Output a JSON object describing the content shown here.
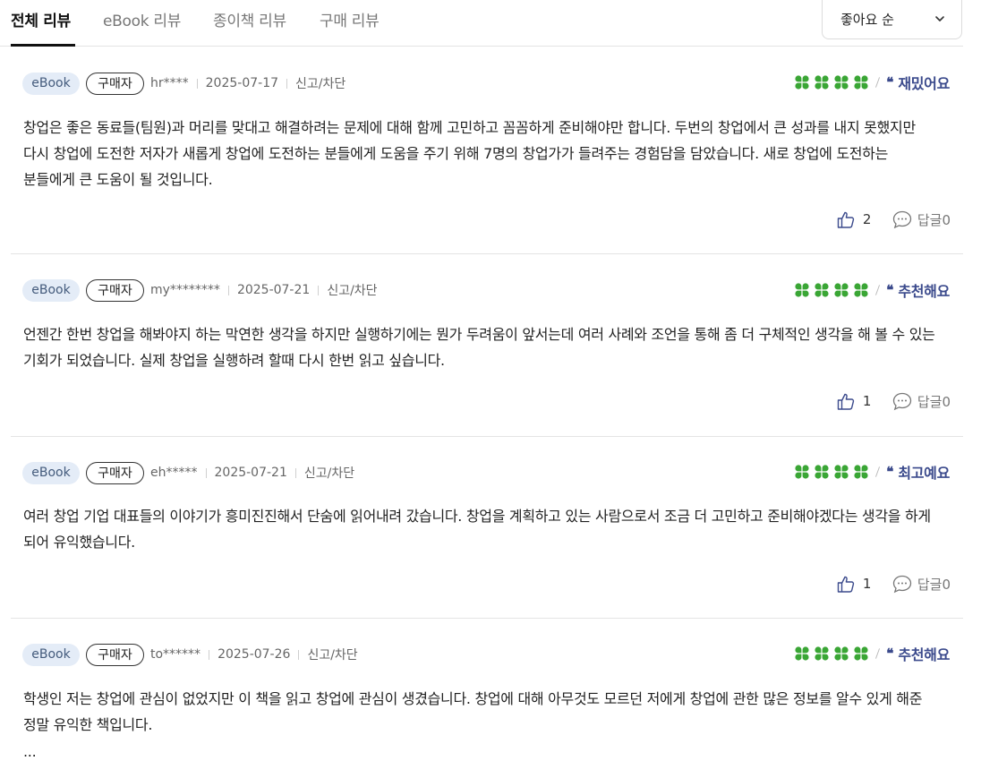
{
  "tabs": [
    {
      "label": "전체 리뷰",
      "active": true
    },
    {
      "label": "eBook 리뷰",
      "active": false
    },
    {
      "label": "종이책 리뷰",
      "active": false
    },
    {
      "label": "구매 리뷰",
      "active": false
    }
  ],
  "sort": {
    "selected": "좋아요 순"
  },
  "colors": {
    "clover": "#3aa635",
    "tag": "#3b4a8c",
    "ebook_badge_bg": "#e4ecf7"
  },
  "reviews": [
    {
      "format": "eBook",
      "buyer_badge": "구매자",
      "user": "hr****",
      "date": "2025-07-17",
      "report": "신고/차단",
      "rating": 4,
      "tag": "재밌어요",
      "text": "창업은 좋은 동료들(팀원)과 머리를 맞대고 해결하려는 문제에 대해 함께 고민하고 꼼꼼하게 준비해야만 합니다. 두번의 창업에서 큰 성과를 내지 못했지만 다시 창업에 도전한 저자가 새롭게 창업에 도전하는 분들에게 도움을 주기 위해 7명의 창업가가 들려주는 경험담을 담았습니다. 새로 창업에 도전하는 분들에게 큰 도움이 될 것입니다.",
      "likes": "2",
      "replies": "답글0"
    },
    {
      "format": "eBook",
      "buyer_badge": "구매자",
      "user": "my********",
      "date": "2025-07-21",
      "report": "신고/차단",
      "rating": 4,
      "tag": "추천해요",
      "text": "언젠간 한번 창업을 해봐야지 하는 막연한 생각을 하지만 실행하기에는 뭔가 두려움이 앞서는데 여러 사례와 조언을 통해 좀 더 구체적인 생각을 해 볼 수 있는 기회가 되었습니다. 실제 창업을 실행하려 할때 다시 한번 읽고 싶습니다.",
      "likes": "1",
      "replies": "답글0"
    },
    {
      "format": "eBook",
      "buyer_badge": "구매자",
      "user": "eh*****",
      "date": "2025-07-21",
      "report": "신고/차단",
      "rating": 4,
      "tag": "최고예요",
      "text": "여러 창업 기업 대표들의 이야기가 흥미진진해서 단숨에 읽어내려 갔습니다. 창업을 계획하고 있는 사람으로서 조금 더 고민하고 준비해야겠다는 생각을 하게 되어 유익했습니다.",
      "likes": "1",
      "replies": "답글0"
    },
    {
      "format": "eBook",
      "buyer_badge": "구매자",
      "user": "to******",
      "date": "2025-07-26",
      "report": "신고/차단",
      "rating": 4,
      "tag": "추천해요",
      "text": "학생인 저는 창업에 관심이 없었지만 이 책을 읽고 창업에 관심이 생겼습니다. 창업에 대해 아무것도 모르던 저에게 창업에 관한 많은 정보를 알수 있게 해준 정말 유익한 책입니다.",
      "more": "..."
    }
  ]
}
